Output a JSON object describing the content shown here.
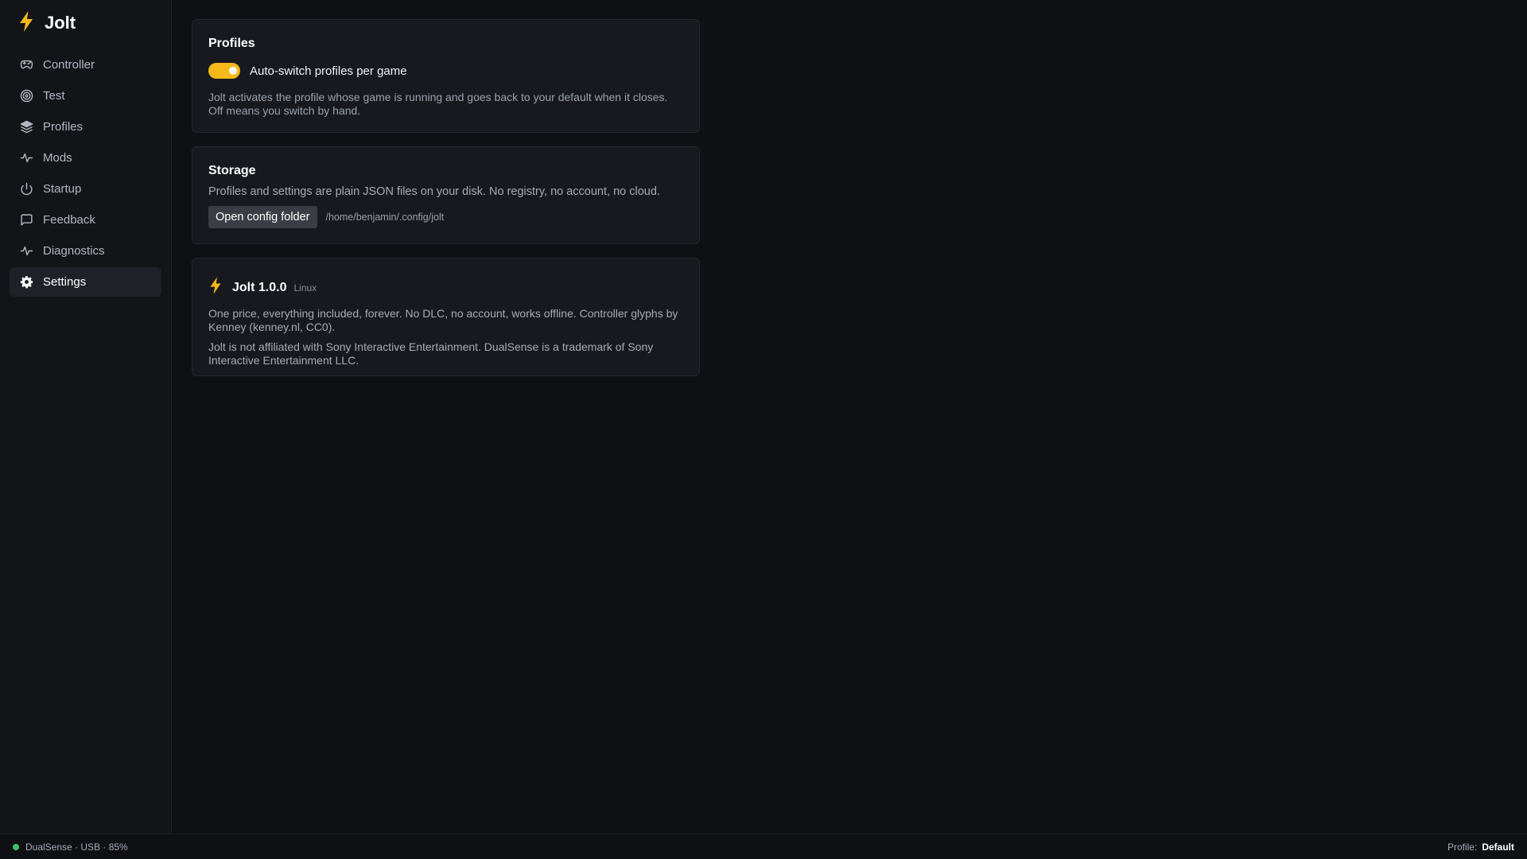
{
  "app": {
    "name": "Jolt",
    "accent_color": "#f5b91a",
    "logo_icon": "bolt-icon"
  },
  "sidebar": {
    "items": [
      {
        "label": "Controller",
        "icon": "gamepad-icon",
        "active": false
      },
      {
        "label": "Test",
        "icon": "target-icon",
        "active": false
      },
      {
        "label": "Profiles",
        "icon": "layers-icon",
        "active": false
      },
      {
        "label": "Mods",
        "icon": "activity-icon",
        "active": false
      },
      {
        "label": "Startup",
        "icon": "power-icon",
        "active": false
      },
      {
        "label": "Feedback",
        "icon": "message-square-icon",
        "active": false
      },
      {
        "label": "Diagnostics",
        "icon": "activity-icon",
        "active": false
      },
      {
        "label": "Settings",
        "icon": "gear-icon",
        "active": true
      }
    ]
  },
  "profiles_card": {
    "title": "Profiles",
    "toggle_label": "Auto-switch profiles per game",
    "toggle_on": true,
    "description": "Jolt activates the profile whose game is running and goes back to your default when it closes. Off means you switch by hand."
  },
  "storage_card": {
    "title": "Storage",
    "description": "Profiles and settings are plain JSON files on your disk. No registry, no account, no cloud.",
    "button_label": "Open config folder",
    "path": "/home/benjamin/.config/jolt"
  },
  "about_card": {
    "name": "Jolt 1.0.0",
    "platform": "Linux",
    "text1": "One price, everything included, forever. No DLC, no account, works offline. Controller glyphs by Kenney (kenney.nl, CC0).",
    "text2": "Jolt is not affiliated with Sony Interactive Entertainment. DualSense is a trademark of Sony Interactive Entertainment LLC."
  },
  "statusbar": {
    "device": "DualSense · USB · 85%",
    "status_color": "#3ec26a",
    "profile_label": "Profile:",
    "profile_name": "Default"
  }
}
